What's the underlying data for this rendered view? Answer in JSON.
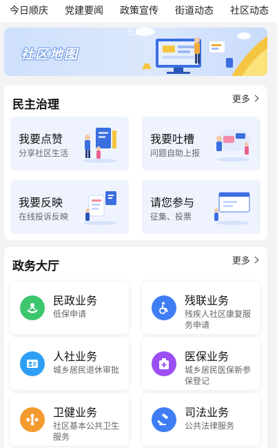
{
  "top_tabs": [
    "今日顺庆",
    "党建要闻",
    "政策宣传",
    "街道动态",
    "社区动态"
  ],
  "banner": {
    "title": "社区地图",
    "overlay_text": "社区"
  },
  "democracy": {
    "title": "民主治理",
    "more": "更多",
    "tiles": [
      {
        "title": "我要点赞",
        "sub": "分享社区生活"
      },
      {
        "title": "我要吐槽",
        "sub": "问题自助上报"
      },
      {
        "title": "我要反映",
        "sub": "在线投诉反映"
      },
      {
        "title": "请您参与",
        "sub": "征集、投票"
      }
    ]
  },
  "services": {
    "title": "政务大厅",
    "more": "更多",
    "items": [
      {
        "title": "民政业务",
        "sub": "低保申请",
        "icon": "civil-affairs-icon",
        "color": "#3ec66f"
      },
      {
        "title": "残联业务",
        "sub": "残疾人社区康复服务申请",
        "icon": "wheelchair-icon",
        "color": "#3f7df4"
      },
      {
        "title": "人社业务",
        "sub": "城乡居民退休审批",
        "icon": "id-card-icon",
        "color": "#2f9ff5"
      },
      {
        "title": "医保业务",
        "sub": "城乡居民医保新参保登记",
        "icon": "medical-kit-icon",
        "color": "#9b4ff2"
      },
      {
        "title": "卫健业务",
        "sub": "社区基本公共卫生服务",
        "icon": "health-icon",
        "color": "#f59a2c"
      },
      {
        "title": "司法业务",
        "sub": "公共法律服务",
        "icon": "gavel-icon",
        "color": "#3f7df4"
      }
    ]
  }
}
